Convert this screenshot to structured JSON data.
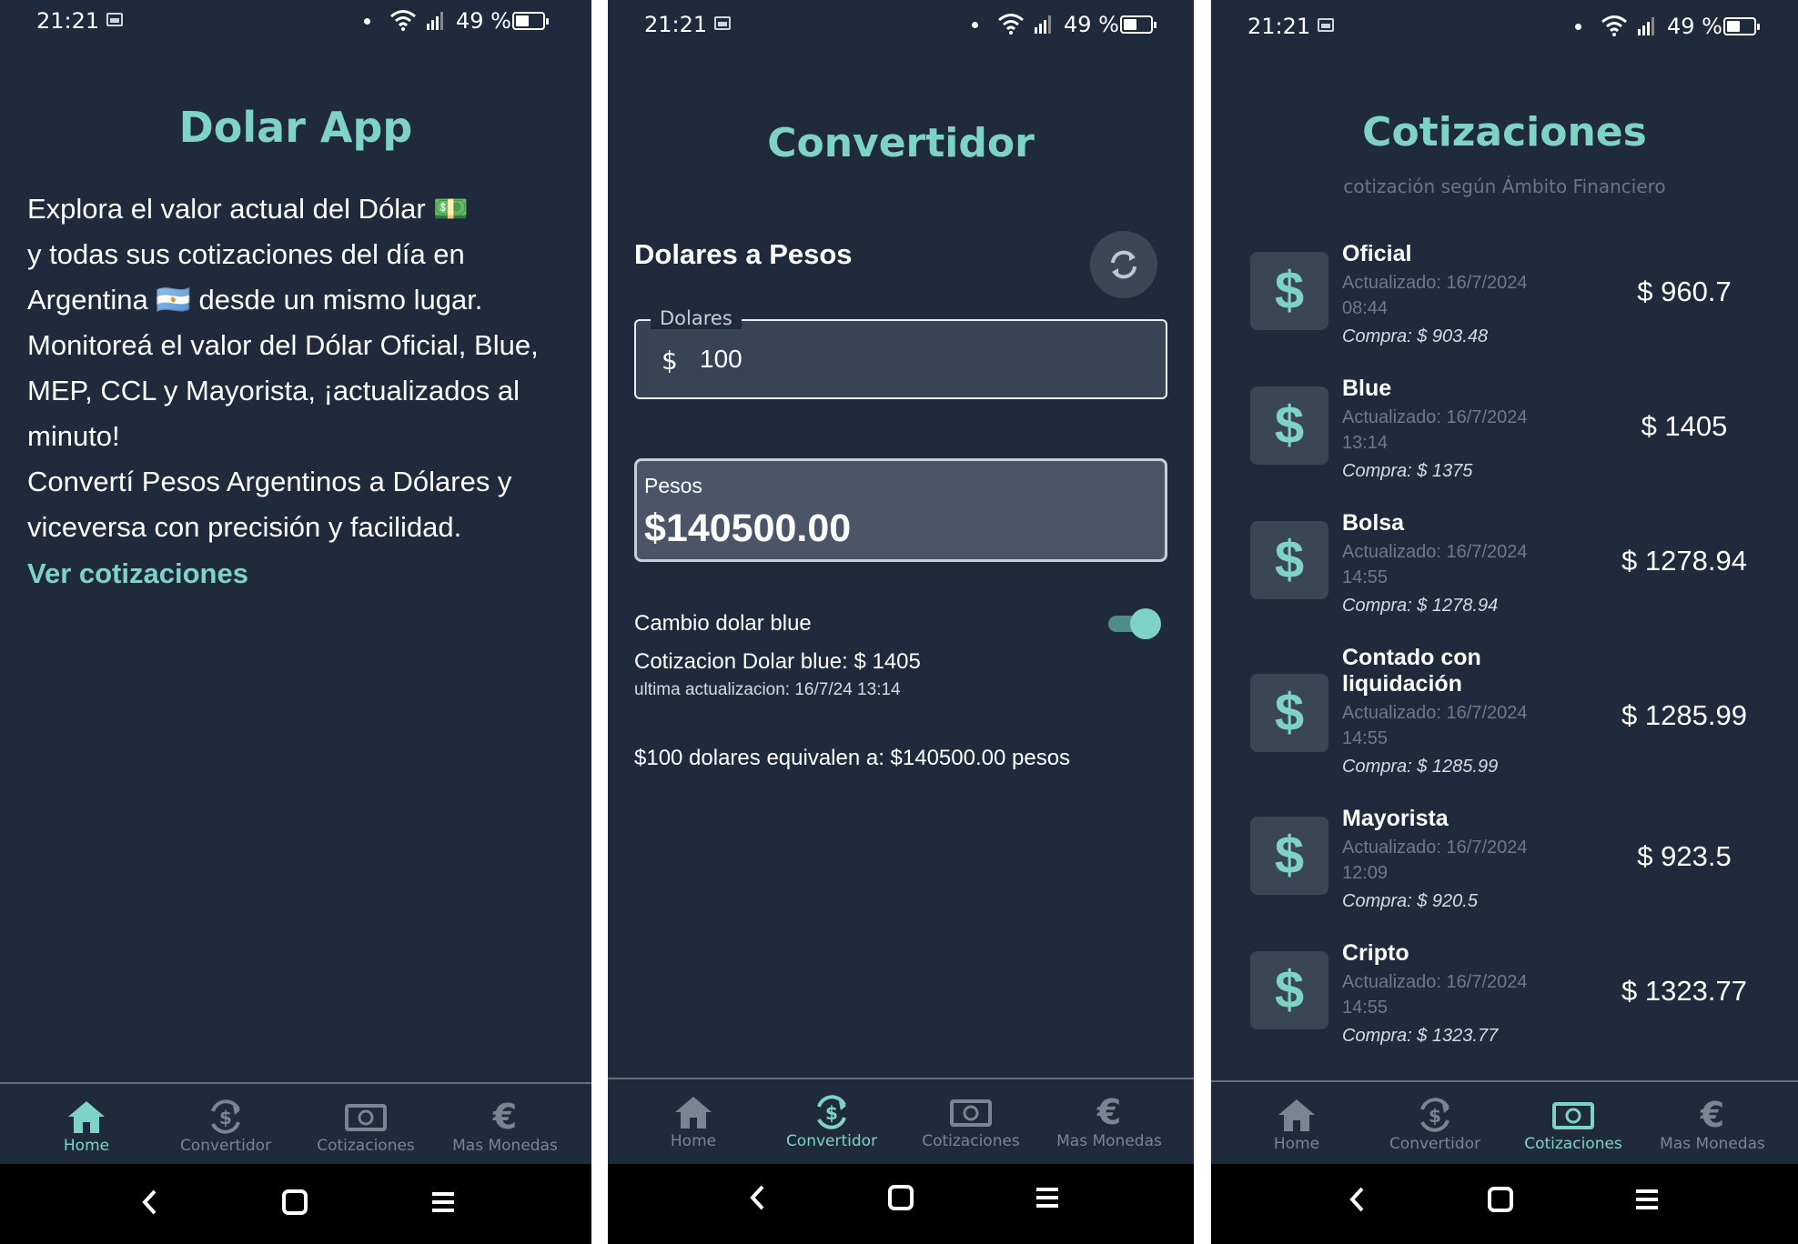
{
  "status": {
    "time": "21:21",
    "battery": "49 %"
  },
  "colors": {
    "background": "#1f2a3c",
    "accent": "#7fd3c4",
    "muted": "#6e7a88"
  },
  "nav": {
    "home": "Home",
    "convertidor": "Convertidor",
    "cotizaciones": "Cotizaciones",
    "mas_monedas": "Mas Monedas"
  },
  "home": {
    "title": "Dolar App",
    "p1": "Explora el valor actual del Dólar 💵",
    "p2": "y todas sus cotizaciones del día en",
    "p3": "Argentina 🇦🇷 desde un mismo lugar.",
    "p4": "Monitoreá el valor del Dólar Oficial, Blue,",
    "p5": "MEP, CCL y Mayorista, ¡actualizados al",
    "p6": "minuto!",
    "p7": "Convertí Pesos Argentinos a Dólares y",
    "p8": "viceversa con precisión y facilidad.",
    "link": "Ver cotizaciones"
  },
  "converter": {
    "title": "Convertidor",
    "section": "Dolares a Pesos",
    "input_label": "Dolares",
    "currency_symbol": "$",
    "input_value": "100",
    "result_label": "Pesos",
    "result_value": "$140500.00",
    "toggle_label": "Cambio dolar blue",
    "blue_quote": "Cotizacion Dolar blue: $ 1405",
    "last_update": "ultima actualizacion: 16/7/24 13:14",
    "equivalence": "$100 dolares equivalen a: $140500.00 pesos",
    "toggle_on": true
  },
  "quotes": {
    "title": "Cotizaciones",
    "subtitle": "cotización según Ámbito Financiero",
    "items": [
      {
        "name": "Oficial",
        "updated_1": "Actualizado: 16/7/2024",
        "updated_2": "08:44",
        "buy": "Compra: $ 903.48",
        "price": "$ 960.7"
      },
      {
        "name": "Blue",
        "updated_1": "Actualizado: 16/7/2024",
        "updated_2": "13:14",
        "buy": "Compra: $ 1375",
        "price": "$ 1405"
      },
      {
        "name": "Bolsa",
        "updated_1": "Actualizado: 16/7/2024",
        "updated_2": "14:55",
        "buy": "Compra: $ 1278.94",
        "price": "$ 1278.94"
      },
      {
        "name": "Contado con liquidación",
        "updated_1": "Actualizado: 16/7/2024",
        "updated_2": "14:55",
        "buy": "Compra: $ 1285.99",
        "price": "$ 1285.99"
      },
      {
        "name": "Mayorista",
        "updated_1": "Actualizado: 16/7/2024",
        "updated_2": "12:09",
        "buy": "Compra: $ 920.5",
        "price": "$ 923.5"
      },
      {
        "name": "Cripto",
        "updated_1": "Actualizado: 16/7/2024",
        "updated_2": "14:55",
        "buy": "Compra: $ 1323.77",
        "price": "$ 1323.77"
      }
    ]
  }
}
